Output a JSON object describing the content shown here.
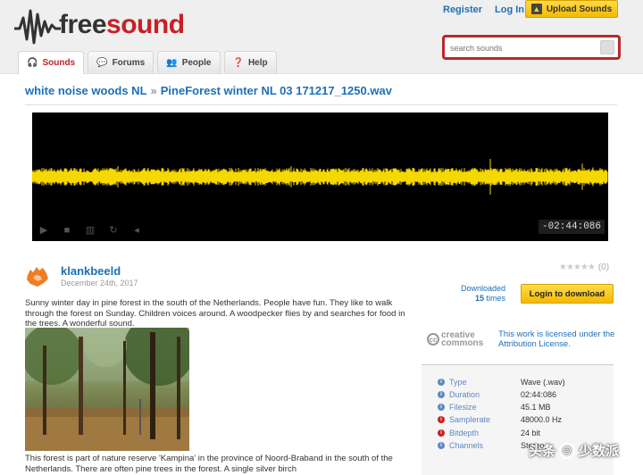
{
  "header": {
    "logo_text_free": "free",
    "logo_text_sound": "sound",
    "register_label": "Register",
    "login_label": "Log In",
    "upload_label": "Upload Sounds",
    "search_placeholder": "search sounds"
  },
  "tabs": [
    {
      "label": "Sounds",
      "icon": "headphones-icon",
      "active": true
    },
    {
      "label": "Forums",
      "icon": "speech-bubble-icon",
      "active": false
    },
    {
      "label": "People",
      "icon": "people-icon",
      "active": false
    },
    {
      "label": "Help",
      "icon": "help-icon",
      "active": false
    }
  ],
  "breadcrumb": {
    "pack": "white noise woods NL",
    "separator": "»",
    "sound": "PineForest winter NL 03 171217_1250.wav"
  },
  "player": {
    "time_remaining": "-02:44:086",
    "wave_color": "#f5d800"
  },
  "sound": {
    "username": "klankbeeld",
    "date": "December 24th, 2017",
    "description1": "Sunny winter day in pine forest in the south of the Netherlands. People have fun. They like to walk through the forest on Sunday. Children voices around. A woodpecker flies by and searches for food in the trees. A wonderful sound.",
    "description2": "This forest is part of nature reserve 'Kampina' in the province of Noord-Braband in the south of the Netherlands. There are often pine trees in the forest. A single silver birch"
  },
  "sidebar": {
    "rating_count": "(0)",
    "downloaded_label": "Downloaded",
    "downloaded_count": "15",
    "downloaded_unit": "times",
    "login_download_label": "Login to download",
    "cc_logo_line1": "creative",
    "cc_logo_line2": "commons",
    "license_text": "This work is licensed under the Attribution License."
  },
  "info": [
    {
      "label": "Type",
      "value": "Wave (.wav)",
      "color": "blue"
    },
    {
      "label": "Duration",
      "value": "02:44:086",
      "color": "blue"
    },
    {
      "label": "Filesize",
      "value": "45.1 MB",
      "color": "blue"
    },
    {
      "label": "Samplerate",
      "value": "48000.0 Hz",
      "color": "red"
    },
    {
      "label": "Bitdepth",
      "value": "24 bit",
      "color": "red"
    },
    {
      "label": "Channels",
      "value": "Stereo",
      "color": "blue"
    }
  ],
  "watermark": {
    "text_left": "头条",
    "text_right": "少数派"
  },
  "colors": {
    "brand_red": "#c72026",
    "link_blue": "#1d6fb8",
    "button_yellow": "#f4b800"
  }
}
